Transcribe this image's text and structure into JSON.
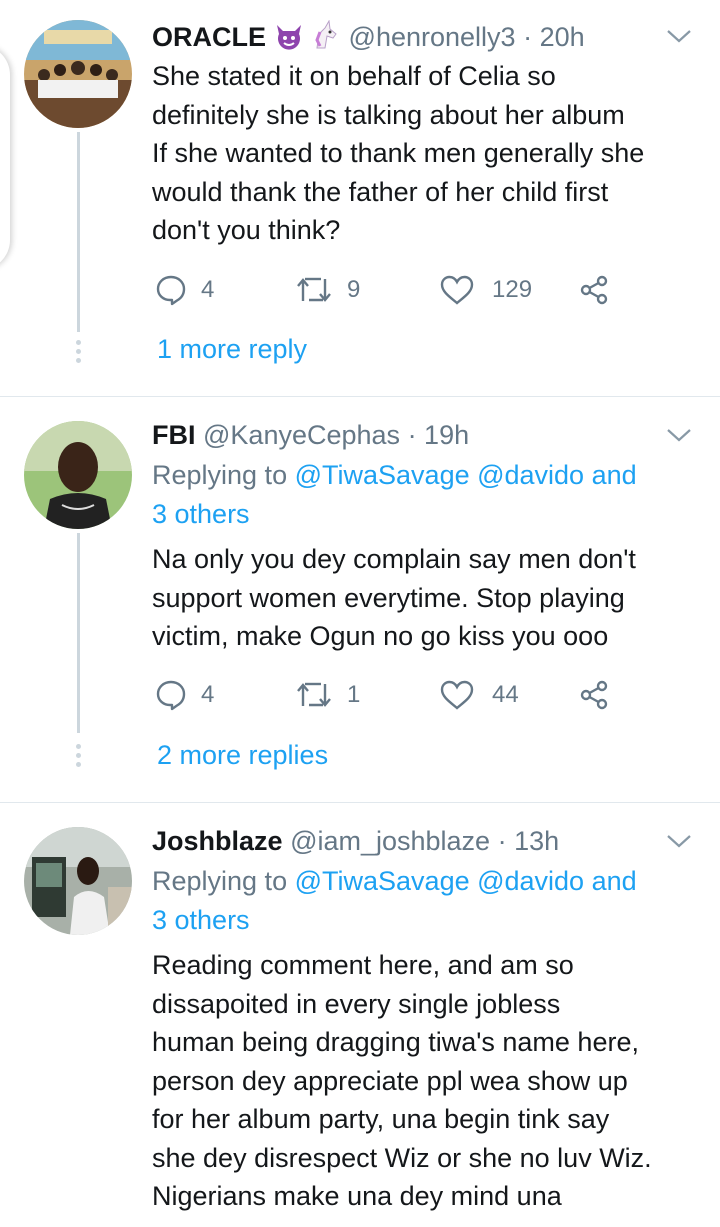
{
  "tweets": [
    {
      "name": "ORACLE",
      "handle": "@henronelly3",
      "time": "· 20h",
      "replying_prefix": "",
      "replying_to": "",
      "text": [
        "She stated it on behalf of Celia so",
        "definitely she is talking about her album",
        "If she wanted to thank men generally she",
        "would thank the father of her child first",
        "don't you think?"
      ],
      "replies": "4",
      "retweets": "9",
      "likes": "129",
      "more_replies": "1 more reply"
    },
    {
      "name": "FBI",
      "handle": "@KanyeCephas",
      "time": "· 19h",
      "replying_prefix": "Replying to",
      "replying_to": "@TiwaSavage @davido and",
      "replying_to_2": "3 others",
      "text": [
        "Na only you dey complain say men don't",
        "support women everytime. Stop playing",
        "victim, make Ogun no go kiss you ooo"
      ],
      "replies": "4",
      "retweets": "1",
      "likes": "44",
      "more_replies": "2 more replies"
    },
    {
      "name": "Joshblaze",
      "handle": "@iam_joshblaze",
      "time": "· 13h",
      "replying_prefix": "Replying to",
      "replying_to": "@TiwaSavage @davido and",
      "replying_to_2": "3 others",
      "text": [
        "Reading comment here, and am so",
        "dissapoited in every single jobless",
        "human being dragging tiwa's name here,",
        "person dey appreciate ppl wea show up",
        "for her album party, una begin tink say",
        "she dey disrespect Wiz or she no luv Wiz.",
        "Nigerians make una dey mind una"
      ]
    }
  ],
  "icons": {
    "reply": "reply-icon",
    "retweet": "retweet-icon",
    "like": "heart-icon",
    "share": "share-icon",
    "more": "chevron-down-icon"
  },
  "colors": {
    "link": "#1da1f2",
    "muted": "#657786",
    "divider": "#e1e8ed"
  }
}
